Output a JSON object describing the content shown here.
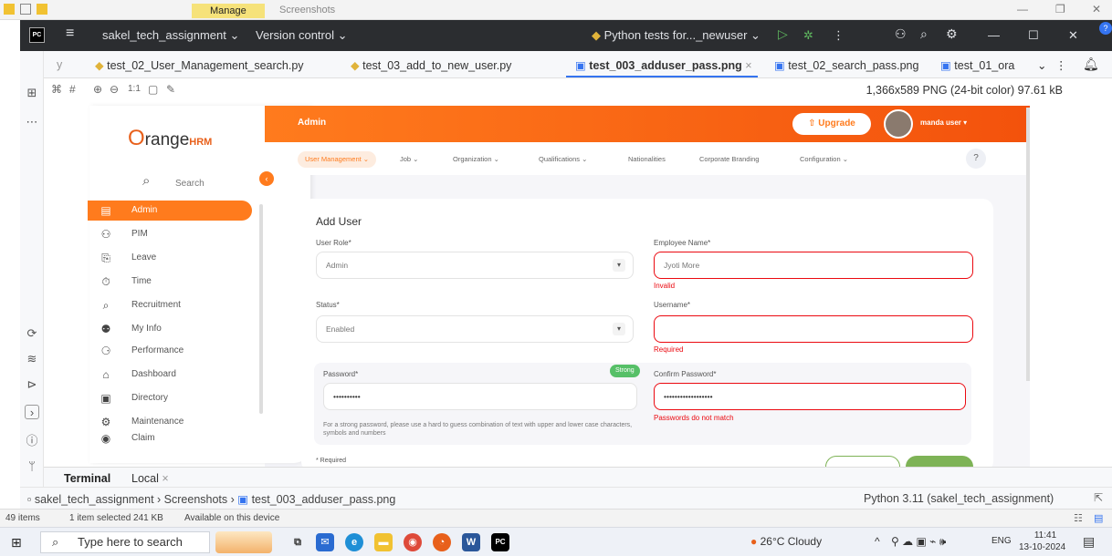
{
  "explorer": {
    "manage": "Manage",
    "screenshots": "Screenshots",
    "minimize": "—",
    "restore": "❐",
    "close": "✕"
  },
  "ide": {
    "project": "sakel_tech_assignment",
    "vcs": "Version control",
    "run_config": "Python tests for..._newuser"
  },
  "tabs": [
    {
      "label": "y"
    },
    {
      "label": "test_02_User_Management_search.py"
    },
    {
      "label": "test_03_add_to_new_user.py"
    },
    {
      "label": "test_003_adduser_pass.png"
    },
    {
      "label": "test_02_search_pass.png"
    },
    {
      "label": "test_01_ora"
    }
  ],
  "image_info": "1,366x589 PNG (24-bit color) 97.61 kB",
  "zoom_label": "1:1",
  "ohrm": {
    "logo_main": "range",
    "logo_hrm": "HRM",
    "search": "Search",
    "nav": [
      "Admin",
      "PIM",
      "Leave",
      "Time",
      "Recruitment",
      "My Info",
      "Performance",
      "Dashboard",
      "Directory",
      "Maintenance",
      "Claim"
    ],
    "header_title": "Admin",
    "upgrade": "Upgrade",
    "user": "manda user ▾",
    "topnav": [
      "User Management",
      "Job",
      "Organization",
      "Qualifications",
      "Nationalities",
      "Corporate Branding",
      "Configuration"
    ],
    "form": {
      "title": "Add User",
      "user_role_label": "User Role*",
      "user_role_value": "Admin",
      "employee_name_label": "Employee Name*",
      "employee_name_value": "Jyoti More",
      "employee_error": "Invalid",
      "status_label": "Status*",
      "status_value": "Enabled",
      "username_label": "Username*",
      "username_error": "Required",
      "password_label": "Password*",
      "password_strength": "Strong",
      "password_value": "••••••••••",
      "confirm_label": "Confirm Password*",
      "confirm_value": "••••••••••••••••••",
      "confirm_error": "Passwords do not match",
      "hint": "For a strong password, please use a hard to guess combination of text with upper and lower case characters, symbols and numbers",
      "required_note": "* Required"
    }
  },
  "terminal": {
    "label": "Terminal",
    "tab": "Local"
  },
  "breadcrumb": {
    "project": "sakel_tech_assignment",
    "folder": "Screenshots",
    "file": "test_003_adduser_pass.png",
    "interpreter": "Python 3.11 (sakel_tech_assignment)"
  },
  "status": {
    "items": "49 items",
    "selected": "1 item selected  241 KB",
    "available": "Available on this device"
  },
  "taskbar": {
    "search": "Type here to search",
    "weather": "26°C  Cloudy",
    "lang": "ENG",
    "time": "11:41",
    "date": "13-10-2024"
  }
}
